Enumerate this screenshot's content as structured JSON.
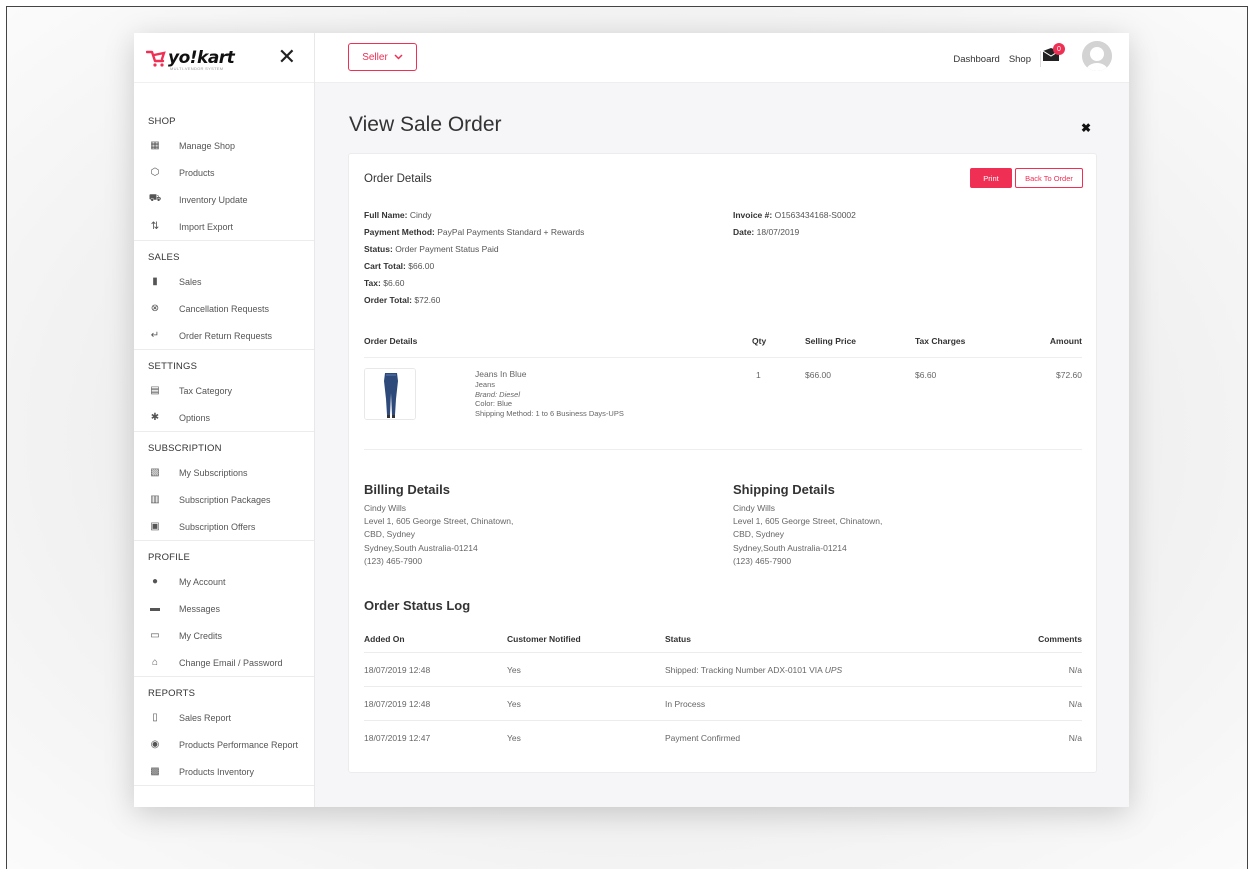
{
  "brand": {
    "name": "yo!kart",
    "tagline": "MULTI-VENDOR SYSTEM"
  },
  "sidebar": {
    "sections": [
      {
        "title": "SHOP",
        "items": [
          {
            "label": "Manage Shop",
            "icon": "store-icon"
          },
          {
            "label": "Products",
            "icon": "box-icon"
          },
          {
            "label": "Inventory Update",
            "icon": "cart-icon"
          },
          {
            "label": "Import Export",
            "icon": "arrows-icon"
          }
        ]
      },
      {
        "title": "SALES",
        "items": [
          {
            "label": "Sales",
            "icon": "bar-chart-icon"
          },
          {
            "label": "Cancellation Requests",
            "icon": "cancel-circle-icon"
          },
          {
            "label": "Order Return Requests",
            "icon": "return-icon"
          }
        ]
      },
      {
        "title": "SETTINGS",
        "items": [
          {
            "label": "Tax Category",
            "icon": "tax-icon"
          },
          {
            "label": "Options",
            "icon": "gear-icon"
          }
        ]
      },
      {
        "title": "SUBSCRIPTION",
        "items": [
          {
            "label": "My Subscriptions",
            "icon": "subscription-icon"
          },
          {
            "label": "Subscription Packages",
            "icon": "package-icon"
          },
          {
            "label": "Subscription Offers",
            "icon": "offer-icon"
          }
        ]
      },
      {
        "title": "PROFILE",
        "items": [
          {
            "label": "My Account",
            "icon": "user-circle-icon"
          },
          {
            "label": "Messages",
            "icon": "message-icon"
          },
          {
            "label": "My Credits",
            "icon": "credit-card-icon"
          },
          {
            "label": "Change Email / Password",
            "icon": "lock-icon"
          }
        ]
      },
      {
        "title": "REPORTS",
        "items": [
          {
            "label": "Sales Report",
            "icon": "report-icon"
          },
          {
            "label": "Products Performance Report",
            "icon": "gauge-icon"
          },
          {
            "label": "Products Inventory",
            "icon": "inventory-icon"
          }
        ]
      }
    ]
  },
  "topbar": {
    "seller_label": "Seller",
    "dashboard": "Dashboard",
    "shop": "Shop",
    "mail_count": "0"
  },
  "page": {
    "title": "View Sale Order"
  },
  "order": {
    "card_title": "Order Details",
    "print_label": "Print",
    "back_label": "Back To Order",
    "left": [
      {
        "label": "Full Name:",
        "value": "Cindy"
      },
      {
        "label": "Payment Method:",
        "value": "PayPal Payments Standard + Rewards"
      },
      {
        "label": "Status:",
        "value": "Order Payment Status Paid"
      },
      {
        "label": "Cart Total:",
        "value": "$66.00"
      },
      {
        "label": "Tax:",
        "value": "$6.60"
      },
      {
        "label": "Order Total:",
        "value": "$72.60"
      }
    ],
    "right": [
      {
        "label": "Invoice #:",
        "value": "O1563434168-S0002"
      },
      {
        "label": "Date:",
        "value": "18/07/2019"
      }
    ],
    "items_headers": {
      "details": "Order Details",
      "qty": "Qty",
      "price": "Selling Price",
      "tax": "Tax Charges",
      "amount": "Amount"
    },
    "item": {
      "name": "Jeans In Blue",
      "category": "Jeans",
      "brand": "Brand: Diesel",
      "color": "Color: Blue",
      "shipping": "Shipping Method: 1 to 6 Business Days-UPS",
      "qty": "1",
      "price": "$66.00",
      "tax": "$6.60",
      "amount": "$72.60"
    }
  },
  "billing": {
    "title": "Billing Details",
    "lines": [
      "Cindy Wills",
      "Level 1, 605 George Street, Chinatown,",
      "CBD, Sydney",
      "Sydney,South Australia-01214",
      "(123) 465-7900"
    ]
  },
  "shipping": {
    "title": "Shipping Details",
    "lines": [
      "Cindy Wills",
      "Level 1, 605 George Street, Chinatown,",
      "CBD, Sydney",
      "Sydney,South Australia-01214",
      "(123) 465-7900"
    ]
  },
  "status_log": {
    "title": "Order Status Log",
    "headers": {
      "added_on": "Added On",
      "notified": "Customer Notified",
      "status": "Status",
      "comments": "Comments"
    },
    "rows": [
      {
        "added_on": "18/07/2019 12:48",
        "notified": "Yes",
        "status": "Shipped: Tracking Number ADX-0101 VIA ",
        "carrier": "UPS",
        "comments": "N/a"
      },
      {
        "added_on": "18/07/2019 12:48",
        "notified": "Yes",
        "status": "In Process",
        "carrier": "",
        "comments": "N/a"
      },
      {
        "added_on": "18/07/2019 12:47",
        "notified": "Yes",
        "status": "Payment Confirmed",
        "carrier": "",
        "comments": "N/a"
      }
    ]
  },
  "colors": {
    "accent": "#ef2f54"
  }
}
